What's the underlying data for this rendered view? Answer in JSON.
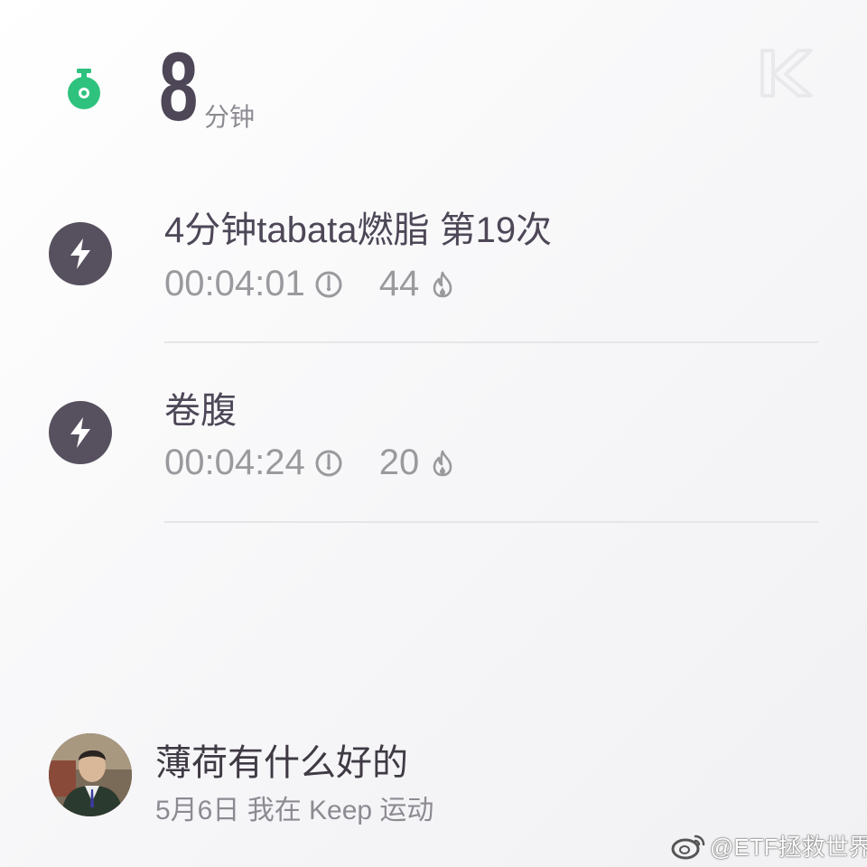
{
  "summary": {
    "duration_value": "8",
    "duration_unit": "分钟"
  },
  "workouts": [
    {
      "title": "4分钟tabata燃脂 第19次",
      "time": "00:04:01",
      "calories": "44"
    },
    {
      "title": "卷腹",
      "time": "00:04:24",
      "calories": "20"
    }
  ],
  "user": {
    "name": "薄荷有什么好的",
    "post_meta": "5月6日 我在 Keep 运动"
  },
  "watermark": {
    "text": "@ETF拯救世界"
  },
  "icons": {
    "timer": "stopwatch-icon",
    "logo": "keep-k-logo",
    "workout": "lightning-bolt-icon",
    "time": "clock-icon",
    "calories": "flame-icon"
  },
  "colors": {
    "accent_green": "#2ec27e",
    "bolt_bg": "#57505f",
    "text_dark": "#4e4757",
    "text_gray": "#9a9a9e"
  }
}
